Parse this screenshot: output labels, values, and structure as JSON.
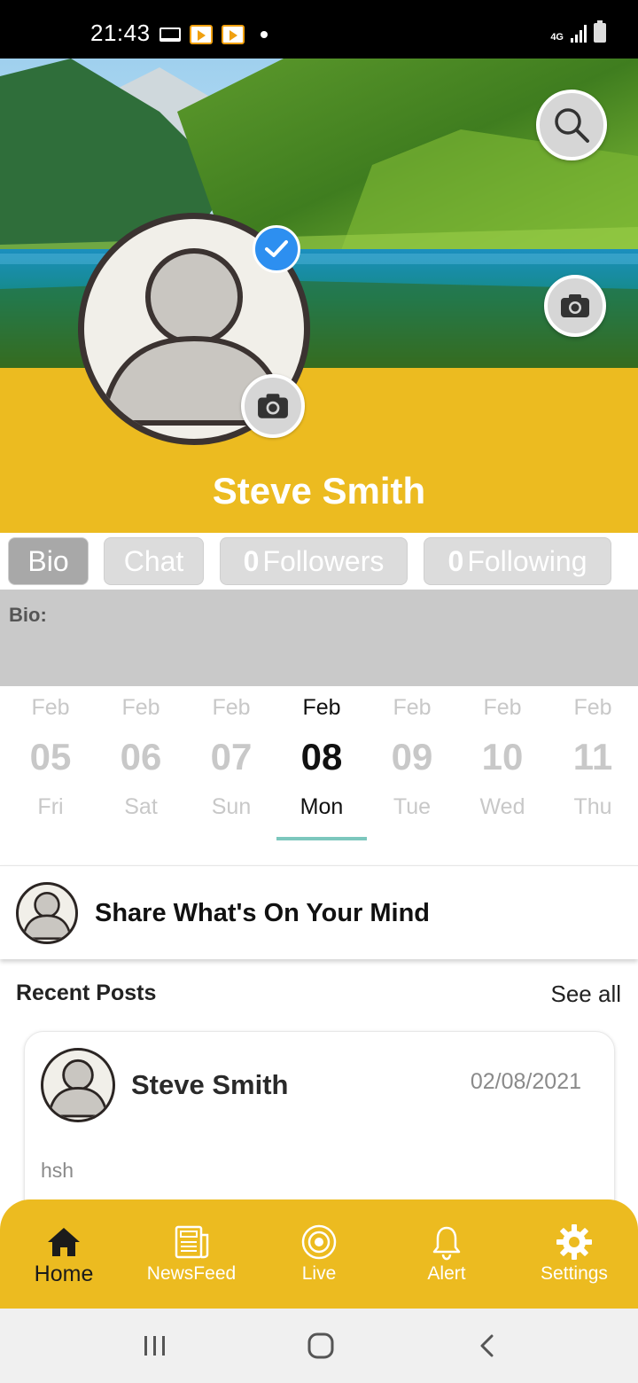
{
  "status_bar": {
    "time": "21:43",
    "network": "4G"
  },
  "profile": {
    "name": "Steve Smith",
    "verified": true
  },
  "tabs": {
    "bio": "Bio",
    "chat": "Chat",
    "followers_count": "0",
    "followers_label": "Followers",
    "following_count": "0",
    "following_label": "Following",
    "active": "Bio"
  },
  "bio": {
    "label": "Bio:",
    "text": ""
  },
  "dates": [
    {
      "month": "Feb",
      "day": "05",
      "weekday": "Fri"
    },
    {
      "month": "Feb",
      "day": "06",
      "weekday": "Sat"
    },
    {
      "month": "Feb",
      "day": "07",
      "weekday": "Sun"
    },
    {
      "month": "Feb",
      "day": "08",
      "weekday": "Mon",
      "selected": true
    },
    {
      "month": "Feb",
      "day": "09",
      "weekday": "Tue"
    },
    {
      "month": "Feb",
      "day": "10",
      "weekday": "Wed"
    },
    {
      "month": "Feb",
      "day": "11",
      "weekday": "Thu"
    }
  ],
  "share": {
    "prompt": "Share What's On Your Mind"
  },
  "recent_posts": {
    "title": "Recent Posts",
    "see_all": "See all",
    "posts": [
      {
        "author": "Steve Smith",
        "date": "02/08/2021",
        "text": "hsh"
      }
    ]
  },
  "bottom_nav": [
    {
      "label": "Home",
      "icon": "home-icon",
      "active": true
    },
    {
      "label": "NewsFeed",
      "icon": "newspaper-icon"
    },
    {
      "label": "Live",
      "icon": "live-icon"
    },
    {
      "label": "Alert",
      "icon": "bell-icon"
    },
    {
      "label": "Settings",
      "icon": "gear-icon"
    }
  ],
  "colors": {
    "accent_yellow": "#ecbb20",
    "verified_blue": "#2d8ff0",
    "tab_active": "#a8a8a8",
    "tab_inactive": "#dcdcdc",
    "date_indicator": "#7cc7bd"
  }
}
